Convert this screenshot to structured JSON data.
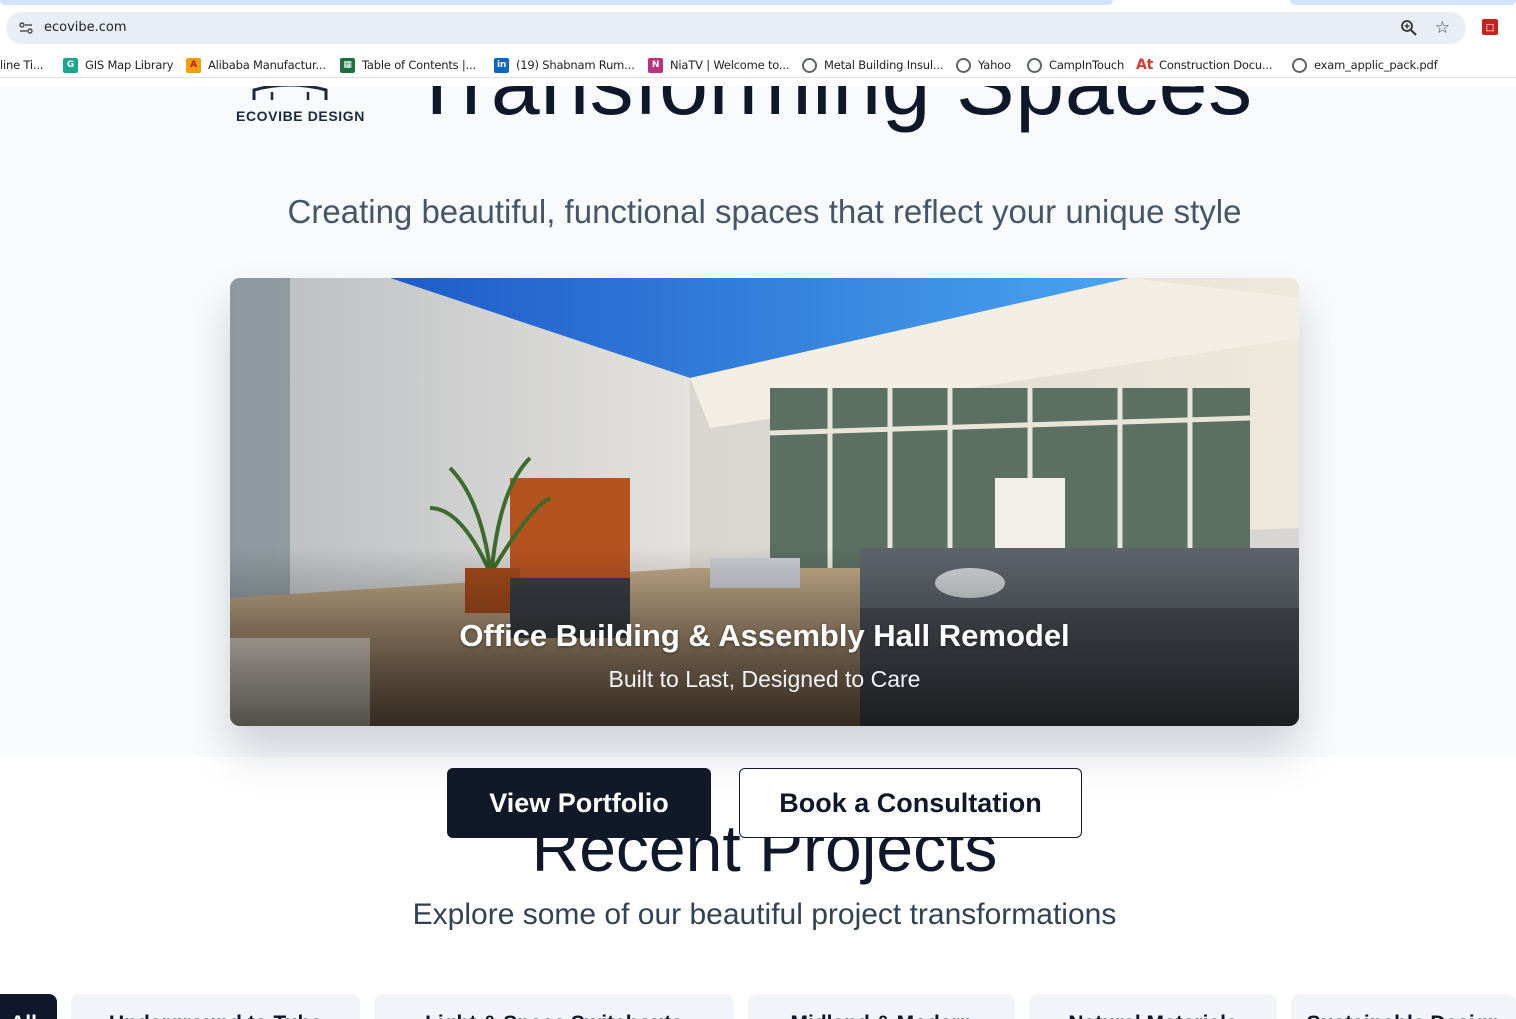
{
  "browser": {
    "url": "ecovibe.com",
    "bookmarks": [
      {
        "label": "line Ti...",
        "icon": "none"
      },
      {
        "label": "GIS Map Library",
        "icon": "gis-icon",
        "color": "#1aa68f"
      },
      {
        "label": "Alibaba Manufactur...",
        "icon": "alibaba-icon",
        "color": "#f59e0b"
      },
      {
        "label": "Table of Contents |...",
        "icon": "table-icon",
        "color": "#1d6f42"
      },
      {
        "label": "(19) Shabnam Rum...",
        "icon": "linkedin-icon",
        "color": "#0a66c2"
      },
      {
        "label": "NiaTV | Welcome to...",
        "icon": "niatv-icon",
        "color": "#b83280"
      },
      {
        "label": "Metal Building Insul...",
        "icon": "globe-icon"
      },
      {
        "label": "Yahoo",
        "icon": "globe-icon"
      },
      {
        "label": "CampInTouch",
        "icon": "globe-icon"
      },
      {
        "label": "Construction Docu...",
        "icon": "at-icon",
        "color": "#d9362b"
      },
      {
        "label": "exam_applic_pack.pdf",
        "icon": "globe-icon"
      }
    ]
  },
  "logo": {
    "text": "ECOVIBE DESIGN"
  },
  "hero": {
    "title": "Transforming Spaces",
    "subtitle": "Creating beautiful, functional spaces that reflect your unique style"
  },
  "feature": {
    "title": "Office Building & Assembly Hall Remodel",
    "subtitle": "Built to Last, Designed to Care"
  },
  "actions": {
    "primary_label": "View Portfolio",
    "secondary_label": "Book a Consultation"
  },
  "recent": {
    "title": "Recent Projects",
    "subtitle": "Explore some of our beautiful project transformations"
  },
  "filters": [
    "All",
    "Underground to Tube",
    "Light & Space Switchouts",
    "Midland & Modern",
    "Natural Materials",
    "Sustainable Design"
  ],
  "colors": {
    "primary": "#111827",
    "hero_bg": "#f8fafc",
    "heading": "#0f172a",
    "muted": "#475569"
  }
}
